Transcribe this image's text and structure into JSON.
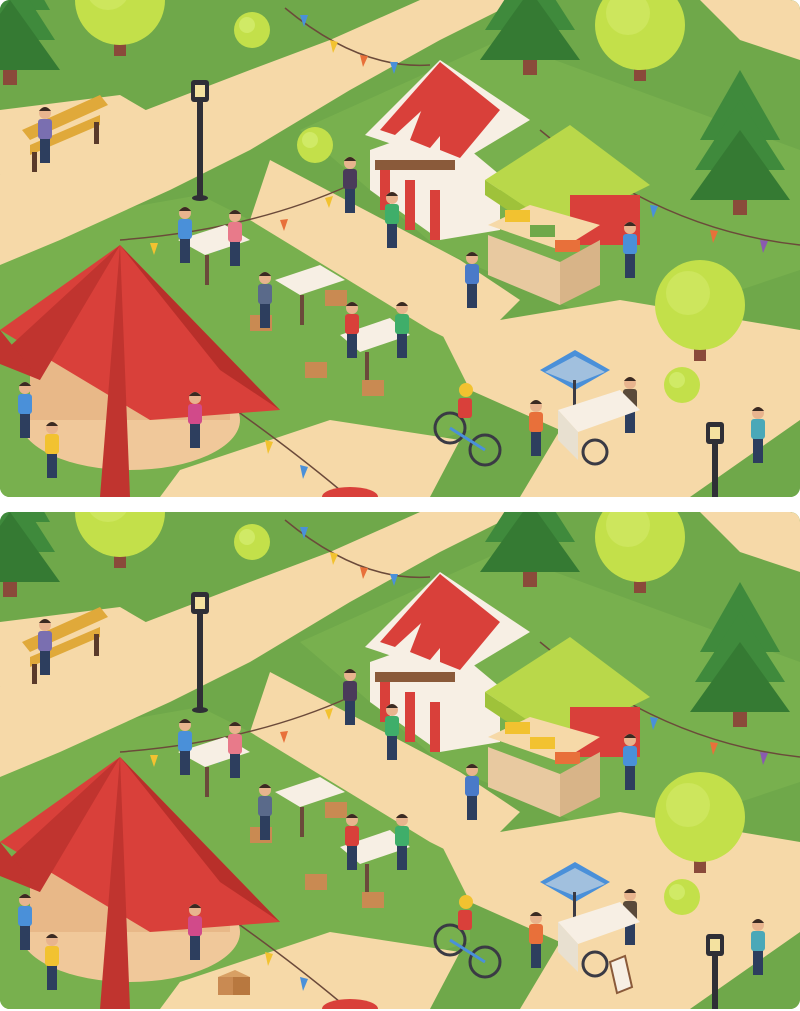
{
  "puzzle": {
    "type": "spot the difference",
    "panels": [
      {
        "id": "original",
        "has_crate": false,
        "has_menu_sign": false
      },
      {
        "id": "modified",
        "has_crate": true,
        "has_menu_sign": true
      }
    ]
  },
  "colors": {
    "grass": "#6fa84a",
    "grass_dark": "#5d9a3e",
    "path": "#f6d9a8",
    "tent_red": "#d9403a",
    "stripe_white": "#f7efe4",
    "canopy_green": "#b9d84a",
    "tree_light": "#c3e04a",
    "tree_dark": "#3f8a3c",
    "trunk": "#8a4a3a"
  }
}
